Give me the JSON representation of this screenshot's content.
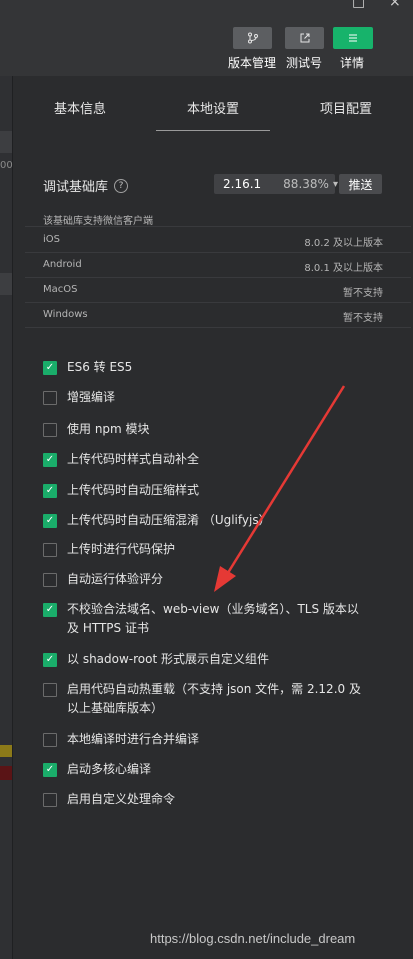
{
  "toolbar": {
    "buttons": [
      {
        "label": "版本管理",
        "icon": "branch-icon"
      },
      {
        "label": "测试号",
        "icon": "external-link-icon"
      },
      {
        "label": "详情",
        "icon": "menu-icon"
      }
    ],
    "window_controls": [
      "□",
      "×"
    ]
  },
  "left_strip": {
    "text": "00"
  },
  "tabs": [
    {
      "label": "基本信息"
    },
    {
      "label": "本地设置",
      "active": true
    },
    {
      "label": "项目配置"
    }
  ],
  "library": {
    "title": "调试基础库",
    "help": "?",
    "version": "2.16.1",
    "percent": "88.38%",
    "caret": "▾",
    "push_label": "推送",
    "support_heading": "该基础库支持微信客户端",
    "platforms": [
      {
        "name": "iOS",
        "support": "8.0.2 及以上版本"
      },
      {
        "name": "Android",
        "support": "8.0.1 及以上版本"
      },
      {
        "name": "MacOS",
        "support": "暂不支持"
      },
      {
        "name": "Windows",
        "support": "暂不支持"
      }
    ]
  },
  "options": [
    {
      "label": "ES6 转 ES5",
      "checked": true
    },
    {
      "label": "增强编译",
      "checked": false
    },
    {
      "label": "使用 npm 模块",
      "checked": false
    },
    {
      "label": "上传代码时样式自动补全",
      "checked": true
    },
    {
      "label": "上传代码时自动压缩样式",
      "checked": true
    },
    {
      "label": "上传代码时自动压缩混淆 （Uglifyjs）",
      "checked": true
    },
    {
      "label": "上传时进行代码保护",
      "checked": false
    },
    {
      "label": "自动运行体验评分",
      "checked": false
    },
    {
      "label": "不校验合法域名、web-view（业务域名）、TLS 版本以及 HTTPS 证书",
      "checked": true
    },
    {
      "label": "以 shadow-root 形式展示自定义组件",
      "checked": true
    },
    {
      "label": "启用代码自动热重载（不支持 json 文件，需 2.12.0 及以上基础库版本）",
      "checked": false
    },
    {
      "label": "本地编译时进行合并编译",
      "checked": false
    },
    {
      "label": "启动多核心编译",
      "checked": true
    },
    {
      "label": "启用自定义处理命令",
      "checked": false
    }
  ],
  "checkmark": "✓",
  "watermark": "https://blog.csdn.net/include_dream",
  "colors": {
    "accent": "#1aad6a",
    "arrow": "#e53935",
    "background": "#2b2c2e"
  }
}
